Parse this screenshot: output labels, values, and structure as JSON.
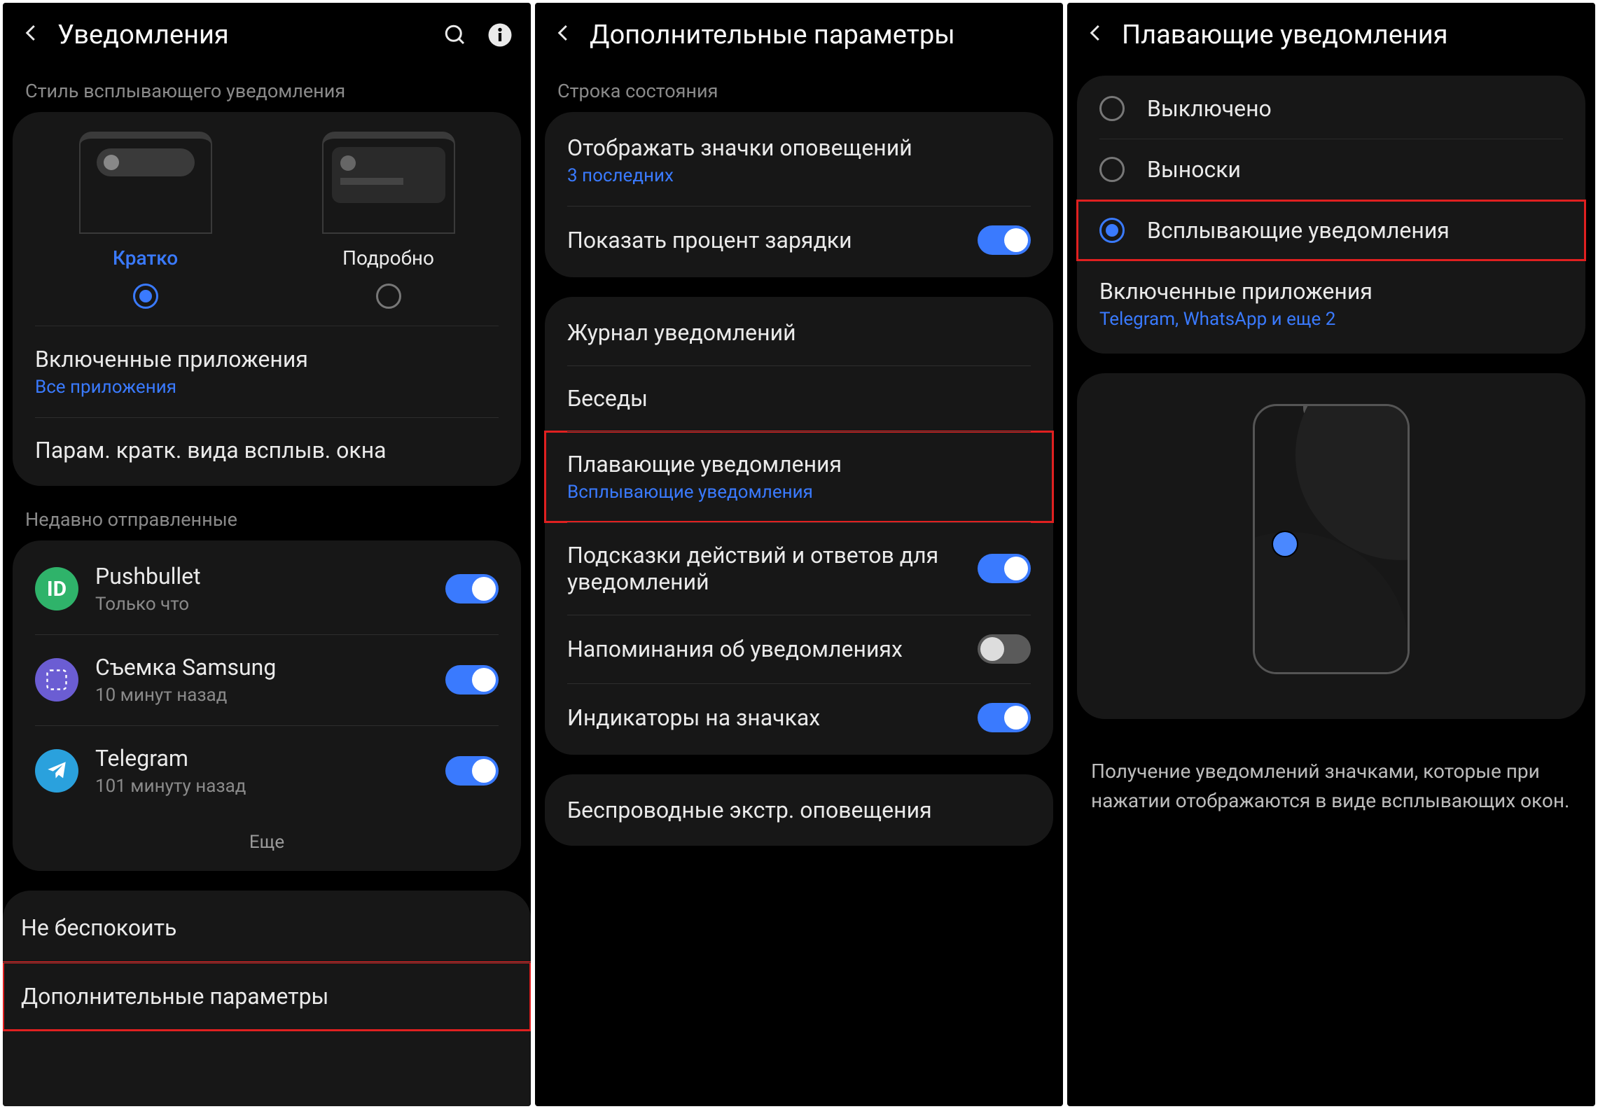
{
  "screen1": {
    "title": "Уведомления",
    "section_style": "Стиль всплывающего уведомления",
    "style_brief": "Кратко",
    "style_detailed": "Подробно",
    "enabled_apps": {
      "title": "Включенные приложения",
      "sub": "Все приложения"
    },
    "brief_params": "Парам. кратк. вида всплыв. окна",
    "section_recent": "Недавно отправленные",
    "apps": [
      {
        "name": "Pushbullet",
        "sub": "Только что",
        "color": "#2fb36a",
        "letter": "ID"
      },
      {
        "name": "Съемка Samsung",
        "sub": "10 минут назад",
        "color": "#6b5dd3",
        "letter": ""
      },
      {
        "name": "Telegram",
        "sub": "101 минуту назад",
        "color": "#2aa1dd",
        "letter": ""
      }
    ],
    "more": "Еще",
    "dnd": "Не беспокоить",
    "advanced": "Дополнительные параметры"
  },
  "screen2": {
    "title": "Дополнительные параметры",
    "section_status": "Строка состояния",
    "show_icons": {
      "title": "Отображать значки оповещений",
      "sub": "3 последних"
    },
    "battery_pct": "Показать процент зарядки",
    "log": "Журнал уведомлений",
    "convs": "Беседы",
    "floating": {
      "title": "Плавающие уведомления",
      "sub": "Всплывающие уведомления"
    },
    "hints": "Подсказки действий и ответов для уведомлений",
    "reminders": "Напоминания об уведомлениях",
    "badges": "Индикаторы на значках",
    "wireless_alerts": "Беспроводные экстр. оповещения"
  },
  "screen3": {
    "title": "Плавающие уведомления",
    "opt_off": "Выключено",
    "opt_callouts": "Выноски",
    "opt_popups": "Всплывающие уведомления",
    "enabled_apps": {
      "title": "Включенные приложения",
      "sub": "Telegram, WhatsApp и еще 2"
    },
    "description": "Получение уведомлений значками, которые при нажатии отображаются в виде всплывающих окон."
  }
}
